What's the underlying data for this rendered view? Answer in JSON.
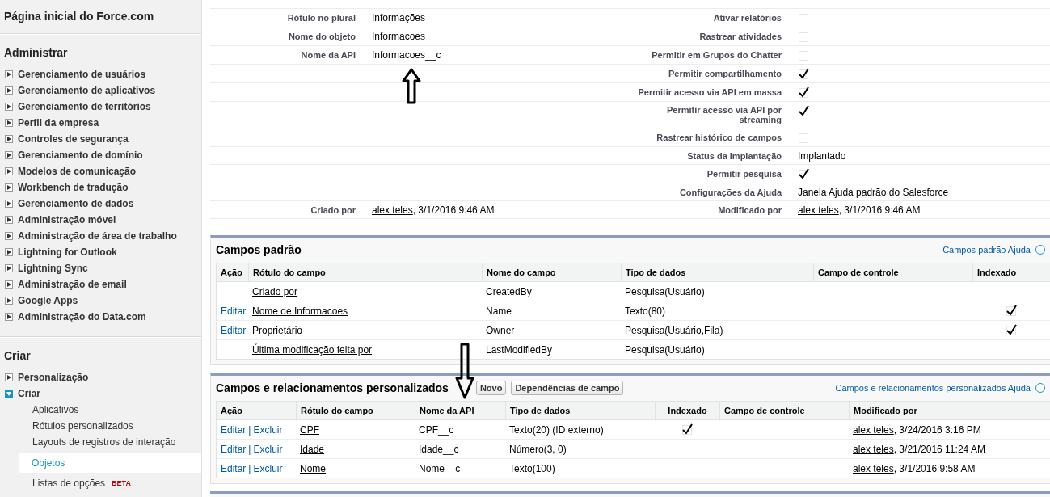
{
  "sidebar": {
    "home_title": "Página inicial do Force.com",
    "sections": [
      {
        "title": "Administrar",
        "items": [
          {
            "label": "Gerenciamento de usuários",
            "expanded": false
          },
          {
            "label": "Gerenciamento de aplicativos",
            "expanded": false
          },
          {
            "label": "Gerenciamento de territórios",
            "expanded": false
          },
          {
            "label": "Perfil da empresa",
            "expanded": false
          },
          {
            "label": "Controles de segurança",
            "expanded": false
          },
          {
            "label": "Gerenciamento de domínio",
            "expanded": false
          },
          {
            "label": "Modelos de comunicação",
            "expanded": false
          },
          {
            "label": "Workbench de tradução",
            "expanded": false
          },
          {
            "label": "Gerenciamento de dados",
            "expanded": false
          },
          {
            "label": "Administração móvel",
            "expanded": false
          },
          {
            "label": "Administração de área de trabalho",
            "expanded": false
          },
          {
            "label": "Lightning for Outlook",
            "expanded": false
          },
          {
            "label": "Lightning Sync",
            "expanded": false
          },
          {
            "label": "Administração de email",
            "expanded": false
          },
          {
            "label": "Google Apps",
            "expanded": false
          },
          {
            "label": "Administração do Data.com",
            "expanded": false
          }
        ]
      },
      {
        "title": "Criar",
        "items": [
          {
            "label": "Personalização",
            "expanded": false
          },
          {
            "label": "Criar",
            "expanded": true,
            "children": [
              {
                "label": "Aplicativos",
                "selected": false
              },
              {
                "label": "Rótulos personalizados",
                "selected": false
              },
              {
                "label": "Layouts de registros de interação",
                "selected": false
              },
              {
                "label": "Objetos",
                "selected": true
              },
              {
                "label": "Listas de opções",
                "badge": "BETA",
                "selected": false
              }
            ]
          }
        ]
      }
    ]
  },
  "details": {
    "rows": [
      {
        "left": {
          "label": "Rótulo no plural",
          "kind": "text",
          "value": "Informações"
        },
        "right": {
          "label": "Ativar relatórios",
          "kind": "checkbox",
          "checked": false
        }
      },
      {
        "left": {
          "label": "Nome do objeto",
          "kind": "text",
          "value": "Informacoes"
        },
        "right": {
          "label": "Rastrear atividades",
          "kind": "checkbox",
          "checked": false
        }
      },
      {
        "left": {
          "label": "Nome da API",
          "kind": "text",
          "value": "Informacoes__c"
        },
        "right": {
          "label": "Permitir em Grupos do Chatter",
          "kind": "checkbox",
          "checked": false
        }
      },
      {
        "right": {
          "label": "Permitir compartilhamento",
          "kind": "checkbox",
          "checked": true
        }
      },
      {
        "right": {
          "label": "Permitir acesso via API em massa",
          "kind": "checkbox",
          "checked": true
        }
      },
      {
        "right": {
          "label": "Permitir acesso via API por streaming",
          "kind": "checkbox",
          "checked": true
        }
      },
      {
        "right": {
          "label": "Rastrear histórico de campos",
          "kind": "checkbox",
          "checked": false
        }
      },
      {
        "right": {
          "label": "Status da implantação",
          "kind": "text",
          "value": "Implantado"
        }
      },
      {
        "right": {
          "label": "Permitir pesquisa",
          "kind": "checkbox",
          "checked": true
        }
      },
      {
        "right": {
          "label": "Configurações da Ajuda",
          "kind": "text",
          "value": "Janela Ajuda padrão do Salesforce"
        }
      },
      {
        "left": {
          "label": "Criado por",
          "kind": "user",
          "user": "alex teles",
          "date": ", 3/1/2016 9:46 AM"
        },
        "right": {
          "label": "Modificado por",
          "kind": "user",
          "user": "alex teles",
          "date": ", 3/1/2016 9:46 AM"
        }
      }
    ]
  },
  "standard_fields": {
    "title": "Campos padrão",
    "help_link": "Campos padrão Ajuda",
    "columns": [
      "Ação",
      "Rótulo do campo",
      "Nome do campo",
      "Tipo de dados",
      "Campo de controle",
      "Indexado"
    ],
    "rows": [
      {
        "label": "Criado por",
        "name": "CreatedBy",
        "type": "Pesquisa(Usuário)"
      },
      {
        "action": "Editar",
        "label": "Nome de Informacoes",
        "name": "Name",
        "type": "Texto(80)",
        "indexed": true
      },
      {
        "action": "Editar",
        "label": "Proprietário",
        "name": "Owner",
        "type": "Pesquisa(Usuário,Fila)",
        "indexed": true
      },
      {
        "label": "Última modificação feita por",
        "name": "LastModifiedBy",
        "type": "Pesquisa(Usuário)"
      }
    ]
  },
  "custom_fields": {
    "title": "Campos e relacionamentos personalizados",
    "buttons": [
      "Novo",
      "Dependências de campo"
    ],
    "help_link": "Campos e relacionamentos personalizados Ajuda",
    "separator": "|",
    "columns": [
      "Ação",
      "Rótulo do campo",
      "Nome da API",
      "Tipo de dados",
      "Indexado",
      "Campo de controle",
      "Modificado por"
    ],
    "rows": [
      {
        "actions": [
          "Editar",
          "Excluir"
        ],
        "label": "CPF",
        "api_name": "CPF__c",
        "type": "Texto(20) (ID externo)",
        "indexed": true,
        "user": "alex teles",
        "date": ", 3/24/2016 3:16 PM"
      },
      {
        "actions": [
          "Editar",
          "Excluir"
        ],
        "label": "Idade",
        "api_name": "Idade__c",
        "type": "Número(3, 0)",
        "user": "alex teles",
        "date": ", 3/21/2016 11:24 AM"
      },
      {
        "actions": [
          "Editar",
          "Excluir"
        ],
        "label": "Nome",
        "api_name": "Nome__c",
        "type": "Texto(100)",
        "user": "alex teles",
        "date": ", 3/1/2016 9:58 AM"
      }
    ]
  }
}
